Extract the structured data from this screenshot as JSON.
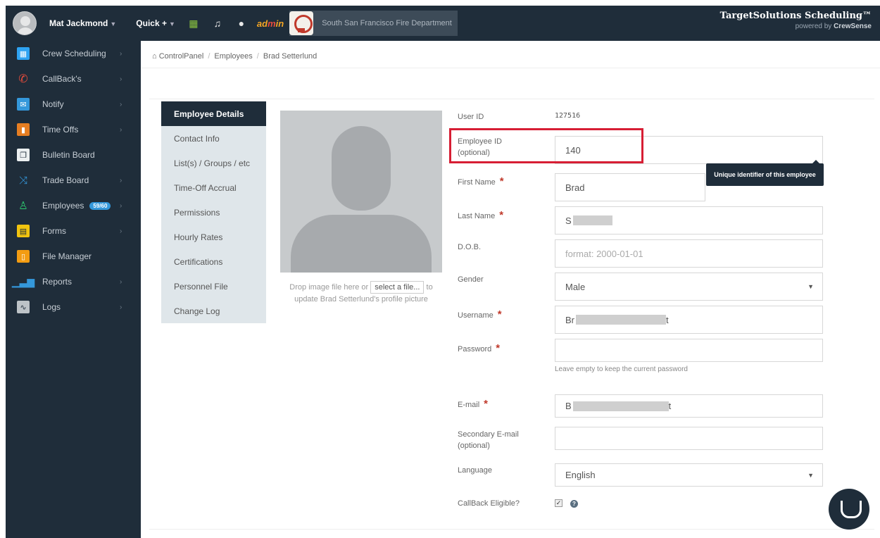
{
  "topbar": {
    "user_name": "Mat Jackmond",
    "quick_label": "Quick +",
    "admin_label_a": "ad",
    "admin_label_b": "m",
    "admin_label_c": "in",
    "department": "South San Francisco Fire Department",
    "brand_title": "TargetSolutions Scheduling™",
    "brand_sub_prefix": "powered by",
    "brand_sub_name": "CrewSense",
    "icons": [
      "calendar-icon",
      "bell-icon",
      "help-icon"
    ]
  },
  "sidebar": {
    "items": [
      {
        "label": "Crew Scheduling",
        "icon": "calendar-icon",
        "color": "#2ea3f2",
        "arrow": true
      },
      {
        "label": "CallBack's",
        "icon": "phone-icon",
        "color": "#e74c3c",
        "arrow": true
      },
      {
        "label": "Notify",
        "icon": "envelope-icon",
        "color": "#3498db",
        "arrow": true
      },
      {
        "label": "Time Offs",
        "icon": "suitcase-icon",
        "color": "#e67e22",
        "arrow": true
      },
      {
        "label": "Bulletin Board",
        "icon": "copy-icon",
        "color": "#ecf0f1",
        "arrow": false
      },
      {
        "label": "Trade Board",
        "icon": "shuffle-icon",
        "color": "#3498db",
        "arrow": true
      },
      {
        "label": "Employees",
        "icon": "user-icon",
        "color": "#2ecc71",
        "arrow": true,
        "badge": "59/60"
      },
      {
        "label": "Forms",
        "icon": "form-icon",
        "color": "#f1c40f",
        "arrow": true
      },
      {
        "label": "File Manager",
        "icon": "file-icon",
        "color": "#f39c12",
        "arrow": false
      },
      {
        "label": "Reports",
        "icon": "bar-chart-icon",
        "color": "#3498db",
        "arrow": true
      },
      {
        "label": "Logs",
        "icon": "log-icon",
        "color": "#bdc3c7",
        "arrow": true
      }
    ]
  },
  "breadcrumb": {
    "home": "ControlPanel",
    "section": "Employees",
    "current": "Brad Setterlund"
  },
  "tabs": [
    {
      "label": "Employee Details",
      "active": true
    },
    {
      "label": "Contact Info",
      "active": false
    },
    {
      "label": "List(s) / Groups / etc",
      "active": false
    },
    {
      "label": "Time-Off Accrual",
      "active": false
    },
    {
      "label": "Permissions",
      "active": false
    },
    {
      "label": "Hourly Rates",
      "active": false
    },
    {
      "label": "Certifications",
      "active": false
    },
    {
      "label": "Personnel File",
      "active": false
    },
    {
      "label": "Change Log",
      "active": false
    }
  ],
  "profile": {
    "drop_text_a": "Drop image file here or",
    "select_button": "select a file...",
    "drop_text_b": "to",
    "drop_text_c": "update Brad Setterlund's profile picture"
  },
  "form": {
    "user_id_label": "User ID",
    "user_id_value": "127516",
    "employee_id_label": "Employee ID",
    "employee_id_sub": "(optional)",
    "employee_id_value": "140",
    "tooltip": "Unique identifier of this employee",
    "first_name_label": "First Name",
    "first_name_value": "Brad",
    "last_name_label": "Last Name",
    "last_name_value": "S",
    "dob_label": "D.O.B.",
    "dob_placeholder": "format: 2000-01-01",
    "gender_label": "Gender",
    "gender_value": "Male",
    "username_label": "Username",
    "username_value": "Br",
    "username_suffix": "t",
    "password_label": "Password",
    "password_hint": "Leave empty to keep the current password",
    "email_label": "E-mail",
    "email_value": "B",
    "email_suffix": "t",
    "secondary_email_label": "Secondary E-mail",
    "secondary_email_sub": "(optional)",
    "language_label": "Language",
    "language_value": "English",
    "callback_label": "CallBack Eligible?",
    "callback_checked": true
  }
}
